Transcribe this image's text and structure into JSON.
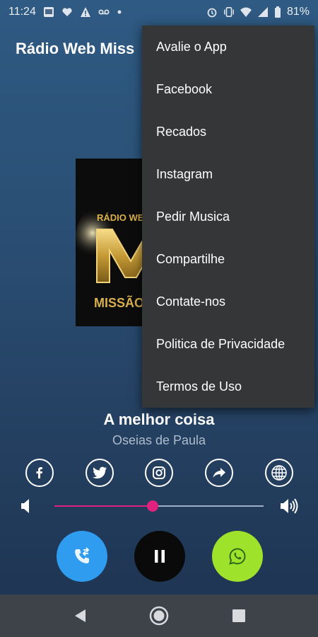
{
  "status_bar": {
    "time": "11:24",
    "battery": "81%",
    "left_icons": [
      "gallery-icon",
      "heart-icon",
      "alert-icon",
      "voicemail-icon",
      "dot-icon"
    ],
    "right_icons": [
      "alarm-icon",
      "vibrate-icon",
      "wifi-icon",
      "signal-icon",
      "battery-icon"
    ]
  },
  "app": {
    "title": "Rádio Web Miss"
  },
  "cover": {
    "logo_text_top": "RÁDIO WEB",
    "logo_text_bottom": "MISSÃO"
  },
  "player": {
    "track_title": "A melhor coisa",
    "artist": "Oseias de Paula",
    "volume_level": 0.47,
    "social": [
      "facebook-icon",
      "twitter-icon",
      "instagram-icon",
      "share-icon",
      "globe-icon"
    ],
    "colors": {
      "slider": "#e0217d",
      "call_button": "#2f9cf0",
      "pause_button": "#0a0a0a",
      "whatsapp_button": "#9fe22c"
    }
  },
  "menu": {
    "items": [
      "Avalie o App",
      "Facebook",
      "Recados",
      "Instagram",
      "Pedir Musica",
      "Compartilhe",
      "Contate-nos",
      "Politica de Privacidade",
      "Termos de Uso"
    ]
  },
  "nav_bar": {
    "buttons": [
      "back-icon",
      "home-icon",
      "recents-icon"
    ]
  }
}
